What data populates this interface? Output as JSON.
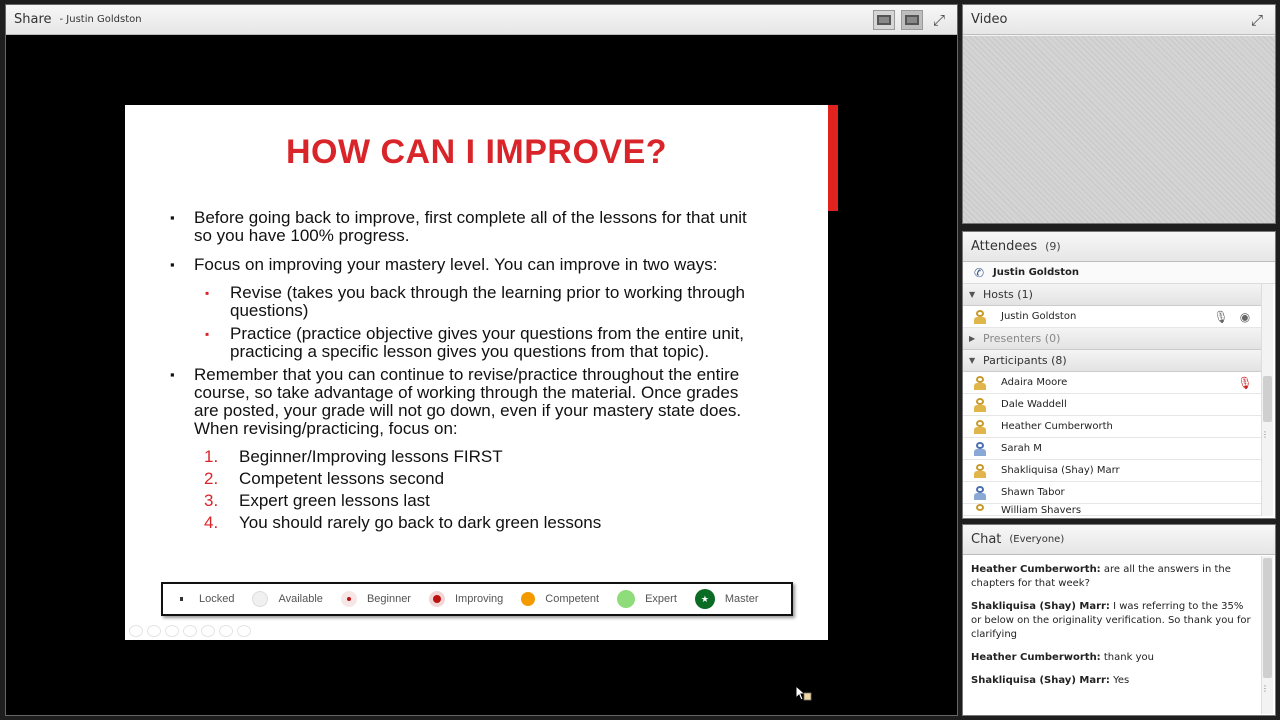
{
  "share": {
    "title": "Share",
    "presenter": "- Justin Goldston"
  },
  "slide": {
    "title": "HOW CAN I IMPROVE?",
    "bullets": [
      "Before going back to improve, first complete all of the lessons for that unit so you have 100% progress.",
      "Focus on improving your mastery level. You can improve in two ways:",
      "Remember that you can continue to revise/practice throughout the entire course, so take advantage of working through the material. Once grades are posted, your grade will not go down, even if your mastery state does. When revising/practicing, focus on:"
    ],
    "sub_bullets": [
      "Revise (takes you back through the learning prior to working through questions)",
      "Practice (practice objective gives your questions from the entire unit, practicing a specific lesson gives you questions from that topic)."
    ],
    "ordered": [
      {
        "num": "1.",
        "text": "Beginner/Improving lessons FIRST"
      },
      {
        "num": "2.",
        "text": "Competent lessons second"
      },
      {
        "num": "3.",
        "text": "Expert green lessons last"
      },
      {
        "num": "4.",
        "text": "You should rarely go back to dark green lessons"
      }
    ],
    "legend": [
      "Locked",
      "Available",
      "Beginner",
      "Improving",
      "Competent",
      "Expert",
      "Master"
    ],
    "accent_color": "#e0231e"
  },
  "video": {
    "title": "Video"
  },
  "attendees": {
    "title": "Attendees",
    "count": "(9)",
    "me": "Justin Goldston",
    "hosts_label": "Hosts (1)",
    "hosts": [
      "Justin Goldston"
    ],
    "presenters_label": "Presenters (0)",
    "participants_label": "Participants (8)",
    "participants": [
      "Adaira Moore",
      "Dale Waddell",
      "Heather Cumberworth",
      "Sarah M",
      "Shakliquisa (Shay) Marr",
      "Shawn Tabor",
      "William Shavers"
    ]
  },
  "chat": {
    "title": "Chat",
    "scope": "(Everyone)",
    "messages": [
      {
        "from": "Heather Cumberworth:",
        "text": "are all the answers in the chapters for that week?"
      },
      {
        "from": "Shakliquisa (Shay) Marr:",
        "text": "I was referring to the 35% or below on the originality verification. So thank you for clarifying"
      },
      {
        "from": "Heather Cumberworth:",
        "text": "thank you"
      },
      {
        "from": "Shakliquisa (Shay) Marr:",
        "text": "Yes"
      }
    ]
  }
}
